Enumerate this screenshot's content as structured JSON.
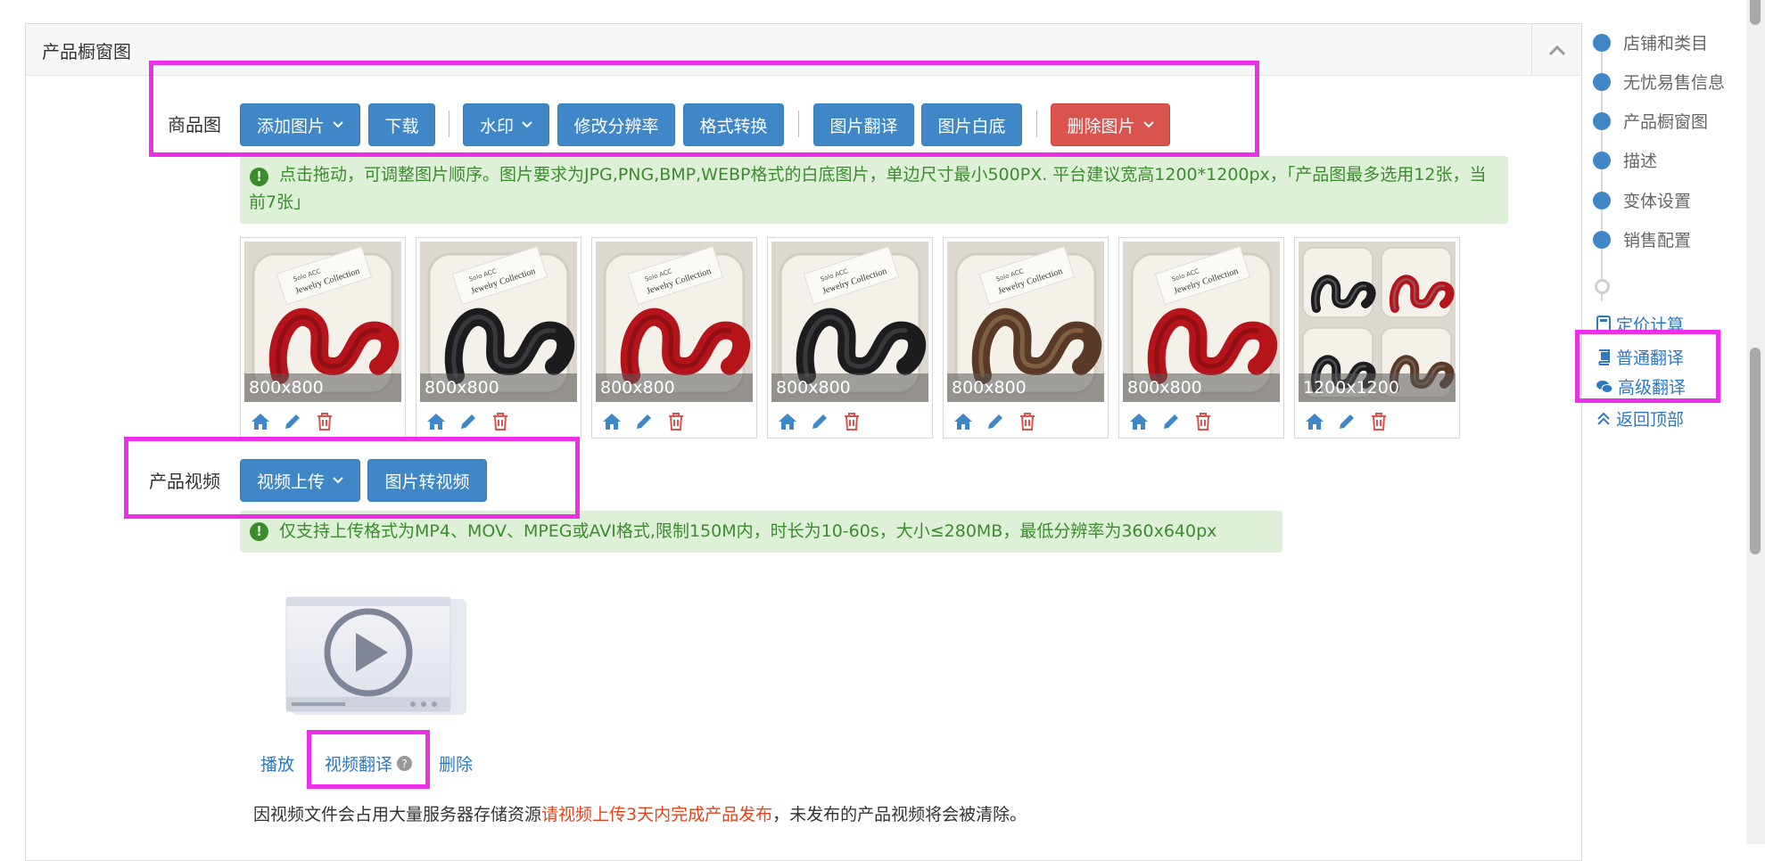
{
  "panel": {
    "title": "产品橱窗图"
  },
  "product_images": {
    "label": "商品图",
    "buttons": {
      "add_image": "添加图片",
      "download": "下载",
      "watermark": "水印",
      "resize": "修改分辨率",
      "format_convert": "格式转换",
      "translate": "图片翻译",
      "white_bg": "图片白底",
      "delete": "删除图片"
    },
    "tip": "点击拖动，可调整图片顺序。图片要求为JPG,PNG,BMP,WEBP格式的白底图片，单边尺寸最小500PX. 平台建议宽高1200*1200px，「产品图最多选用12张，当前7张」",
    "thumbs": [
      {
        "size": "800x800",
        "color": "red"
      },
      {
        "size": "800x800",
        "color": "black"
      },
      {
        "size": "800x800",
        "color": "red"
      },
      {
        "size": "800x800",
        "color": "black"
      },
      {
        "size": "800x800",
        "color": "tortoise"
      },
      {
        "size": "800x800",
        "color": "red"
      },
      {
        "size": "1200x1200",
        "color": "collage"
      }
    ],
    "thumb_icons": [
      "home-icon",
      "pencil-icon",
      "trash-icon"
    ]
  },
  "product_video": {
    "label": "产品视频",
    "buttons": {
      "upload": "视频上传",
      "image_to_video": "图片转视频"
    },
    "tip": "仅支持上传格式为MP4、MOV、MPEG或AVI格式,限制150M内，时长为10-60s，大小≤280MB，最低分辨率为360x640px",
    "actions": {
      "play": "播放",
      "translate": "视频翻译",
      "delete": "删除"
    },
    "note_prefix": "因视频文件会占用大量服务器存储资源",
    "note_highlight": "请视频上传3天内完成产品发布",
    "note_suffix": "，未发布的产品视频将会被清除。"
  },
  "side_nav": {
    "items": [
      "店铺和类目",
      "无忧易售信息",
      "产品橱窗图",
      "描述",
      "变体设置",
      "销售配置"
    ],
    "pricing": "定价计算",
    "normal_translate": "普通翻译",
    "advanced_translate": "高级翻译",
    "back_to_top": "返回顶部"
  },
  "colors": {
    "primary": "#3f87c7",
    "danger": "#d9534f",
    "alert_bg": "#dff0d8",
    "alert_text": "#3c8b2e",
    "highlight": "#ee2fe9",
    "link": "#2e78c0"
  }
}
